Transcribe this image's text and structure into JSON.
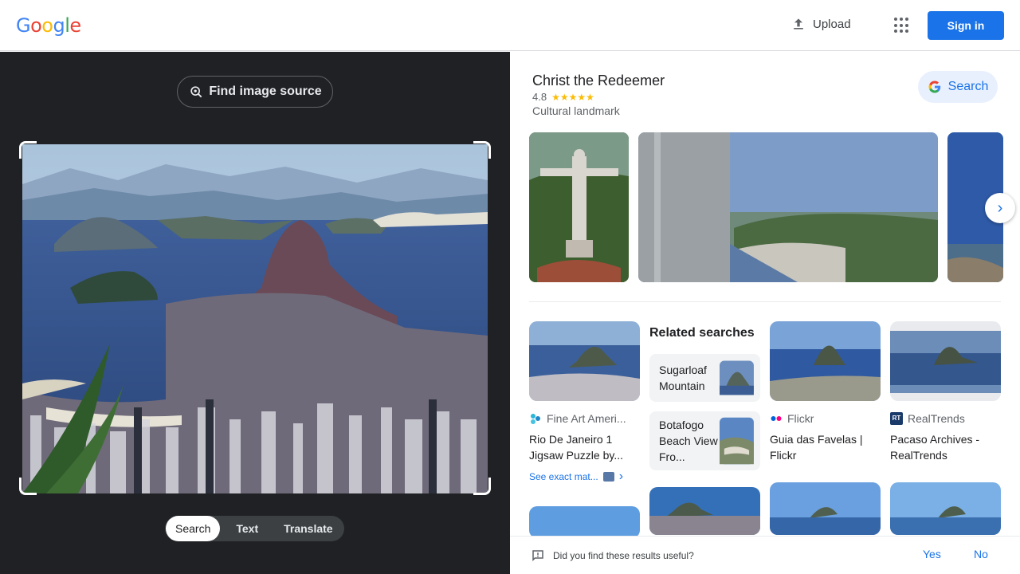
{
  "header": {
    "logo": "Google",
    "upload_label": "Upload",
    "signin_label": "Sign in"
  },
  "left": {
    "find_source": "Find image source",
    "modes": [
      "Search",
      "Text",
      "Translate"
    ],
    "active_mode": "Search"
  },
  "panel": {
    "title": "Christ the Redeemer",
    "rating": "4.8",
    "stars": "★★★★★",
    "type": "Cultural landmark",
    "search_label": "Search"
  },
  "results": [
    {
      "source": "Fine Art Ameri...",
      "title": "Rio De Janeiro 1 Jigsaw Puzzle by...",
      "see_exact": "See exact mat..."
    },
    {
      "source": "Flickr",
      "title": "Guia das Favelas | Flickr"
    },
    {
      "source": "RealTrends",
      "title": "Pacaso Archives - RealTrends",
      "source_badge": "RT"
    }
  ],
  "related": {
    "heading": "Related searches",
    "items": [
      "Sugarloaf Mountain",
      "Botafogo Beach View Fro..."
    ]
  },
  "feedback": {
    "question": "Did you find these results useful?",
    "yes": "Yes",
    "no": "No"
  },
  "colors": {
    "accent": "#1a73e8",
    "dark_pane": "#202124",
    "star": "#fbbc04"
  }
}
